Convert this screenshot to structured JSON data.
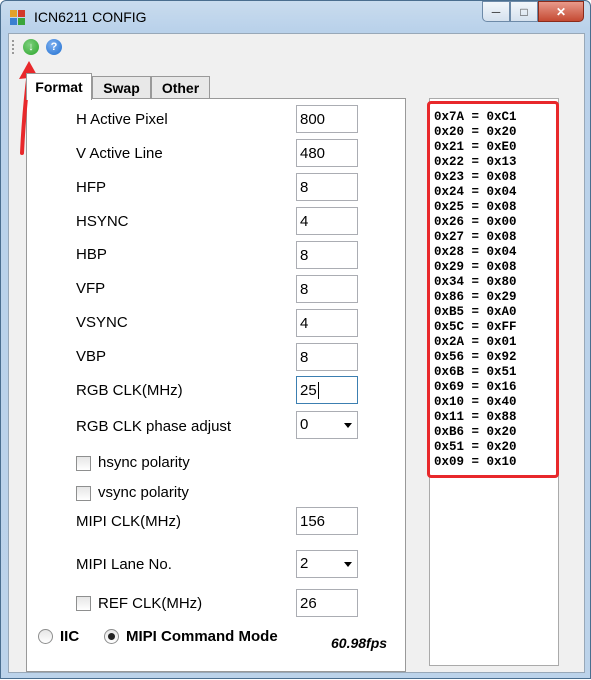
{
  "window": {
    "title": "ICN6211 CONFIG"
  },
  "toolbar": {
    "buttons": [
      {
        "icon": "download-icon"
      },
      {
        "icon": "help-icon",
        "label": "?"
      }
    ]
  },
  "tabs": [
    "Format",
    "Swap",
    "Other"
  ],
  "form": {
    "h_active_pixel": {
      "label": "H Active Pixel",
      "value": "800"
    },
    "v_active_line": {
      "label": "V Active Line",
      "value": "480"
    },
    "hfp": {
      "label": "HFP",
      "value": "8"
    },
    "hsync": {
      "label": "HSYNC",
      "value": "4"
    },
    "hbp": {
      "label": "HBP",
      "value": "8"
    },
    "vfp": {
      "label": "VFP",
      "value": "8"
    },
    "vsync": {
      "label": "VSYNC",
      "value": "4"
    },
    "vbp": {
      "label": "VBP",
      "value": "8"
    },
    "rgb_clk": {
      "label": "RGB CLK(MHz)",
      "value": "25"
    },
    "rgb_phase": {
      "label": "RGB CLK phase adjust",
      "value": "0"
    },
    "hsync_polarity": {
      "label": "hsync polarity"
    },
    "vsync_polarity": {
      "label": "vsync polarity"
    },
    "mipi_clk": {
      "label": "MIPI CLK(MHz)",
      "value": "156"
    },
    "mipi_lane": {
      "label": "MIPI Lane No.",
      "value": "2"
    },
    "ref_clk": {
      "label": "REF CLK(MHz)",
      "value": "26"
    }
  },
  "mode": {
    "iic_label": "IIC",
    "mipi_label": "MIPI Command Mode",
    "selected": "MIPI Command Mode"
  },
  "fps": "60.98fps",
  "registers": [
    "0x7A = 0xC1",
    "0x20 = 0x20",
    "0x21 = 0xE0",
    "0x22 = 0x13",
    "0x23 = 0x08",
    "0x24 = 0x04",
    "0x25 = 0x08",
    "0x26 = 0x00",
    "0x27 = 0x08",
    "0x28 = 0x04",
    "0x29 = 0x08",
    "0x34 = 0x80",
    "0x86 = 0x29",
    "0xB5 = 0xA0",
    "0x5C = 0xFF",
    "0x2A = 0x01",
    "0x56 = 0x92",
    "0x6B = 0x51",
    "0x69 = 0x16",
    "0x10 = 0x40",
    "0x11 = 0x88",
    "0xB6 = 0x20",
    "0x51 = 0x20",
    "0x09 = 0x10"
  ],
  "colors": {
    "highlight": "#e8282b",
    "download": "#2aa52a",
    "help": "#1e6fd0"
  }
}
